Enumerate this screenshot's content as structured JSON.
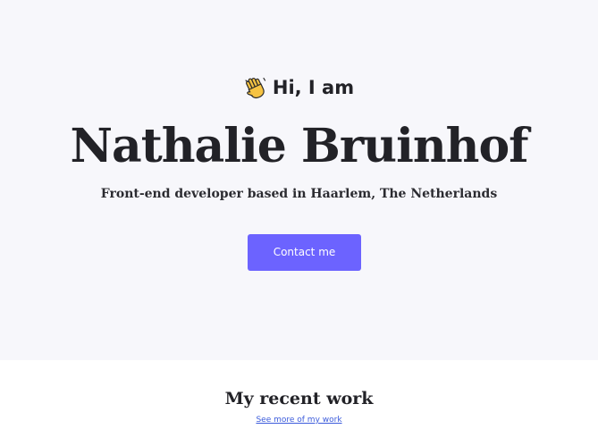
{
  "hero": {
    "greeting_icon": "waving-hand-icon",
    "greeting": "Hi, I am",
    "name": "Nathalie Bruinhof",
    "tagline": "Front-end developer based in Haarlem, The Netherlands",
    "contact_label": "Contact me"
  },
  "work": {
    "title": "My recent work",
    "link_label": "See more of my work"
  },
  "colors": {
    "accent": "#6c63ff",
    "hero_background": "#f7f7fb",
    "text": "#222227",
    "link": "#3b5bdb"
  }
}
